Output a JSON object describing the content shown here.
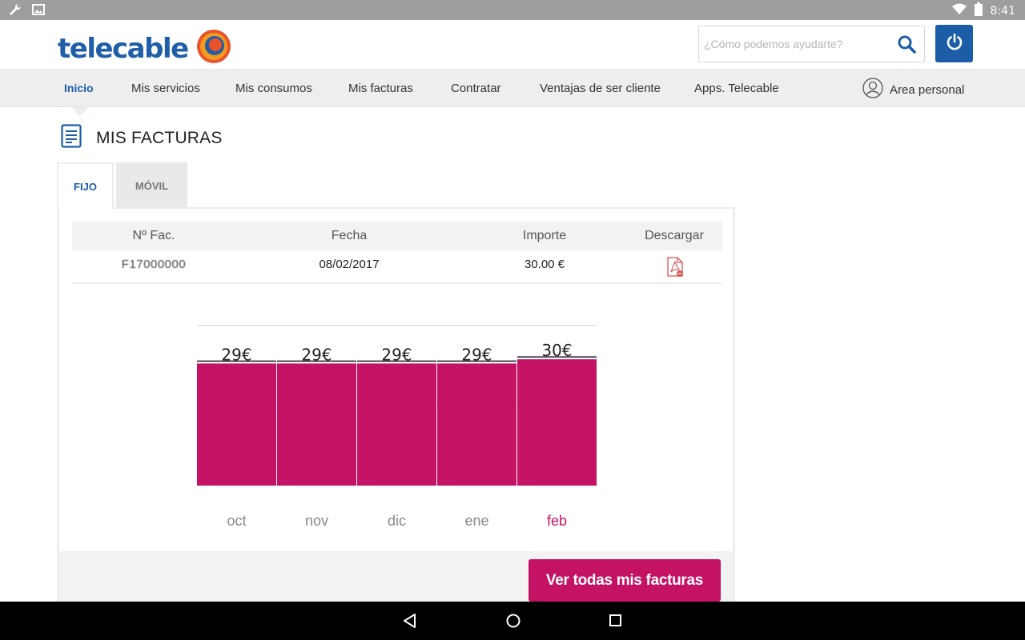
{
  "status_bar": {
    "time": "8:41",
    "icons": [
      "wrench-icon",
      "image-icon",
      "wifi-icon",
      "battery-icon"
    ]
  },
  "header": {
    "logo_text": "telecable",
    "search": {
      "placeholder": "¿Cómo podemos ayudarte?",
      "value": ""
    },
    "brand_color": "#1c5da8"
  },
  "nav": {
    "items": [
      "Inicio",
      "Mis servicios",
      "Mis consumos",
      "Mis facturas",
      "Contratar",
      "Ventajas de ser cliente",
      "Apps. Telecable"
    ],
    "active": "Inicio",
    "area_personal": "Area personal"
  },
  "page": {
    "title": "MIS FACTURAS"
  },
  "tabs": {
    "items": [
      "FIJO",
      "MÓVIL"
    ],
    "active": "FIJO"
  },
  "invoices": {
    "columns": [
      "Nº Fac.",
      "Fecha",
      "Importe",
      "Descargar"
    ],
    "rows": [
      {
        "number": "F17000000",
        "date": "08/02/2017",
        "amount": "30.00 €",
        "download_icon": "pdf-icon"
      }
    ]
  },
  "chart_data": {
    "type": "bar",
    "categories": [
      "oct",
      "nov",
      "dic",
      "ene",
      "feb"
    ],
    "values": [
      29,
      29,
      29,
      29,
      30
    ],
    "data_labels": [
      "29€",
      "29€",
      "29€",
      "29€",
      "30€"
    ],
    "highlight_category": "feb",
    "bar_color": "#c41264",
    "highlight_label_color": "#c41264",
    "label_color": "#888888",
    "grid": true
  },
  "actions": {
    "view_all": "Ver todas mis facturas",
    "accent": "#c41264"
  },
  "system_nav": {
    "icons": [
      "back-icon",
      "home-icon",
      "recents-icon"
    ]
  }
}
